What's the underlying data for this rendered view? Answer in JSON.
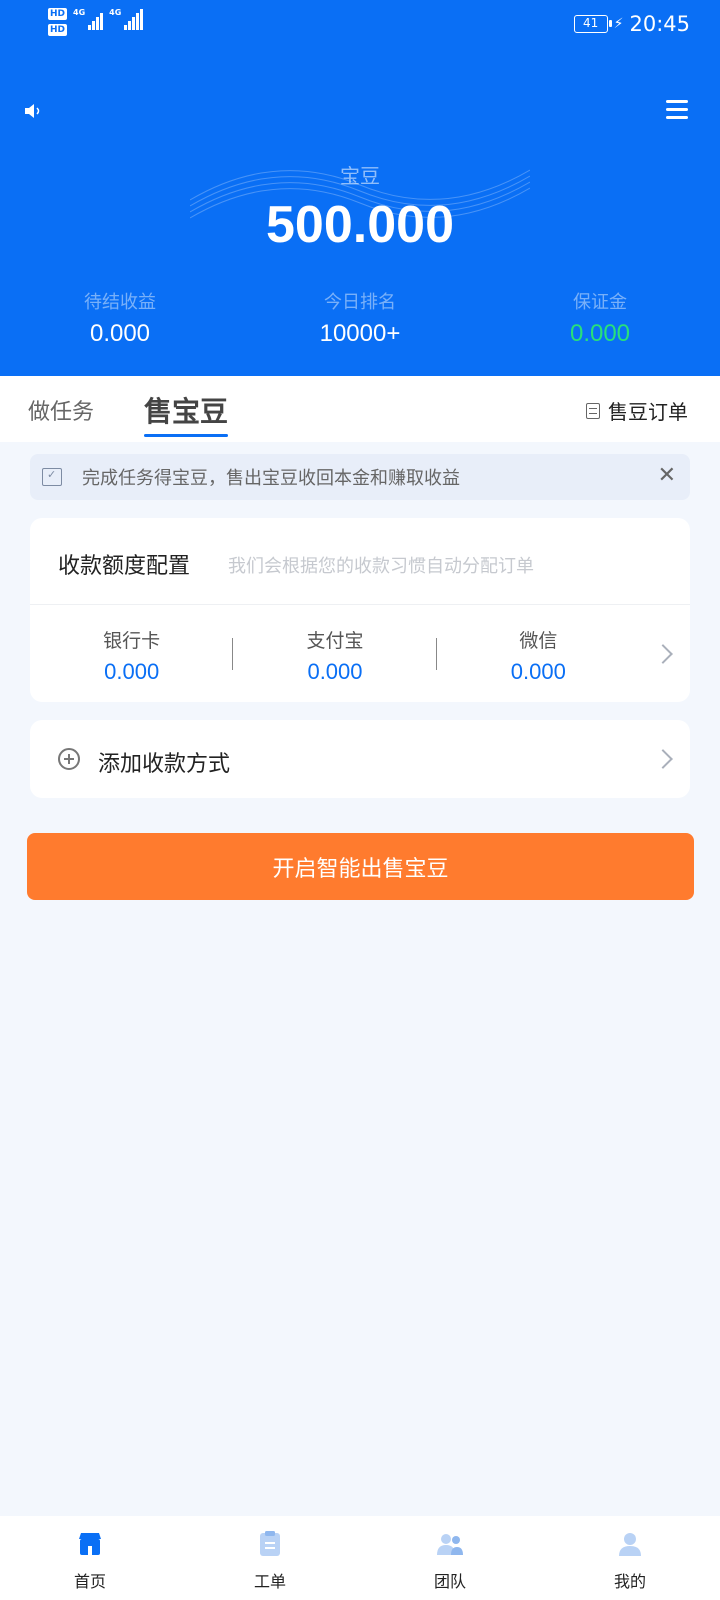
{
  "status_bar": {
    "network_1": "4G",
    "network_2": "4G",
    "battery": "41",
    "time": "20:45"
  },
  "header": {
    "balance_label": "宝豆",
    "balance_value": "500.000",
    "stats": [
      {
        "label": "待结收益",
        "value": "0.000"
      },
      {
        "label": "今日排名",
        "value": "10000+"
      },
      {
        "label": "保证金",
        "value": "0.000"
      }
    ]
  },
  "tabs": {
    "task": "做任务",
    "sell": "售宝豆",
    "orders": "售豆订单"
  },
  "notice": {
    "text": "完成任务得宝豆，售出宝豆收回本金和赚取收益",
    "close": "✕"
  },
  "quota": {
    "title": "收款额度配置",
    "hint": "我们会根据您的收款习惯自动分配订单",
    "methods": [
      {
        "label": "银行卡",
        "value": "0.000"
      },
      {
        "label": "支付宝",
        "value": "0.000"
      },
      {
        "label": "微信",
        "value": "0.000"
      }
    ]
  },
  "add_payment": {
    "label": "添加收款方式"
  },
  "sell_button": "开启智能出售宝豆",
  "bottom_nav": [
    {
      "label": "首页",
      "icon": "home-icon",
      "active": true
    },
    {
      "label": "工单",
      "icon": "clipboard-icon",
      "active": false
    },
    {
      "label": "团队",
      "icon": "team-icon",
      "active": false
    },
    {
      "label": "我的",
      "icon": "profile-icon",
      "active": false
    }
  ],
  "colors": {
    "primary": "#0a6ff5",
    "accent_orange": "#ff7b2e",
    "positive_green": "#28e07a",
    "inactive_icon": "#b9d2f5"
  }
}
